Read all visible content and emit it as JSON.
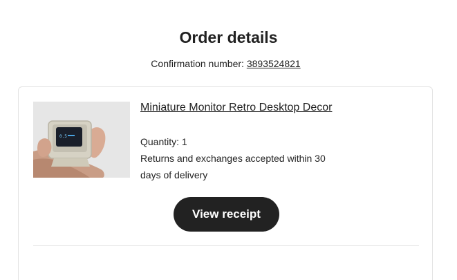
{
  "header": {
    "title": "Order details",
    "confirmation_label": "Confirmation number: ",
    "confirmation_number": "3893524821"
  },
  "order_item": {
    "product_name": "Miniature Monitor Retro Desktop Decor",
    "image_icon": "product-photo-miniature-monitor",
    "quantity_text": "Quantity: 1",
    "returns_text": "Returns and exchanges accepted within 30 days of delivery",
    "view_receipt_label": "View receipt"
  },
  "colors": {
    "text": "#222222",
    "button_bg": "#222222",
    "button_text": "#ffffff",
    "border": "#e3e3e3"
  }
}
